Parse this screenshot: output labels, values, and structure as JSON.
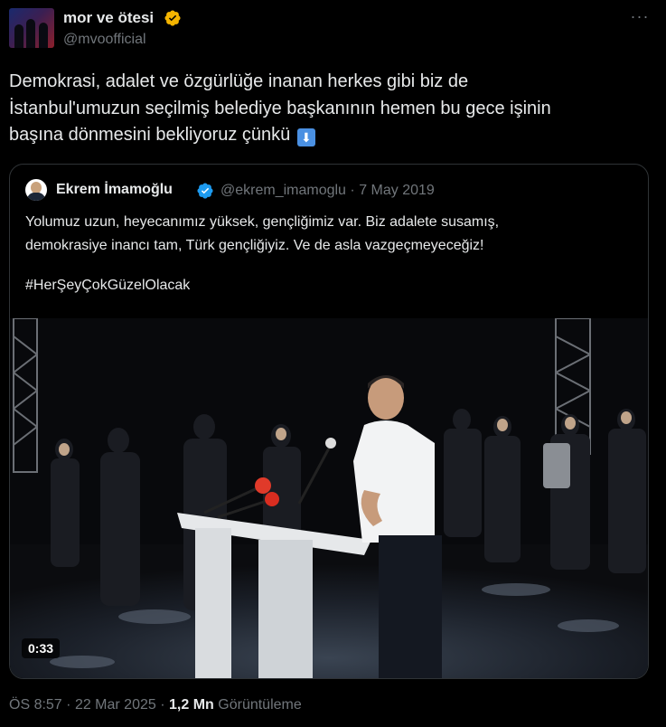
{
  "author": {
    "display_name": "mor ve ötesi",
    "handle": "@mvoofficial",
    "verified_color": "#f4b400"
  },
  "tweet": {
    "lines": [
      "Demokrasi, adalet ve özgürlüğe inanan herkes gibi biz de",
      "İstanbul'umuzun seçilmiş belediye başkanının hemen bu gece işinin",
      "başına dönmesini bekliyoruz çünkü"
    ],
    "emoji": "⬇",
    "more_label": "···"
  },
  "quoted": {
    "display_name": "Ekrem İmamoğlu",
    "handle": "@ekrem_imamoglu",
    "separator": "·",
    "date": "7 May 2019",
    "verified_color": "#1d9bf0",
    "text_lines": [
      "Yolumuz uzun, heyecanımız yüksek, gençliğimiz var. Biz adalete susamış,",
      "demokrasiye inancı tam, Türk gençliğiyiz. Ve de asla vazgeçmeyeceğiz!"
    ],
    "hashtag": "#HerŞeyÇokGüzelOlacak",
    "video_duration": "0:33"
  },
  "footer": {
    "time": "ÖS 8:57",
    "dot1": "·",
    "date": "22 Mar 2025",
    "dot2": "·",
    "views_count": "1,2 Mn",
    "views_label": "Görüntüleme"
  },
  "colors": {
    "background": "#000000",
    "text": "#e7e9ea",
    "secondary_text": "#71767b",
    "border": "#2f3336"
  }
}
